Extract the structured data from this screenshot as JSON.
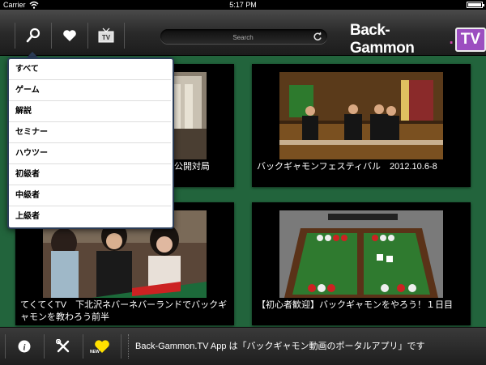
{
  "statusbar": {
    "carrier": "Carrier",
    "time": "5:17 PM"
  },
  "toolbar": {
    "search_placeholder": "Search"
  },
  "logo": {
    "main": "Back-Gammon",
    "dot": ".",
    "tv": "TV"
  },
  "dropdown": {
    "items": [
      "すべて",
      "ゲーム",
      "解説",
      "セミナー",
      "ハウツー",
      "初級者",
      "中級者",
      "上級者"
    ]
  },
  "videos": [
    {
      "caption": "公開対局"
    },
    {
      "caption": "バックギャモンフェスティバル　2012.10.6-8"
    },
    {
      "caption": "てくてくTV　下北沢ネバーネバーランドでバックギャモンを教わろう前半"
    },
    {
      "caption": "【初心者歓迎】バックギャモンをやろう！１日目"
    }
  ],
  "bottombar": {
    "new_badge": "NEW",
    "info_text": "Back-Gammon.TV App は「バックギャモン動画のポータルアプリ」です"
  },
  "colors": {
    "felt": "#22643c",
    "accent": "#9c4ec0",
    "heart": "#ffe000"
  }
}
